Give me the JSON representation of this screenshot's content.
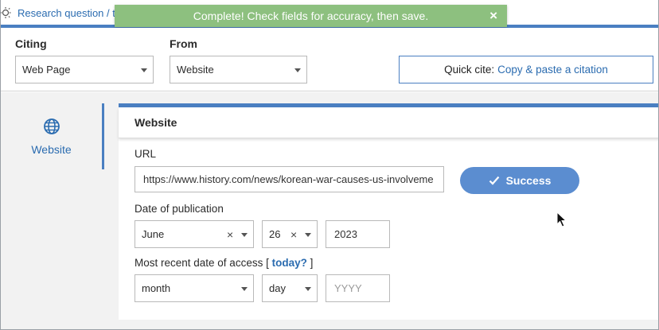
{
  "breadcrumb": "Research question / t",
  "toast": {
    "message": "Complete! Check fields for accuracy, then save.",
    "close": "×"
  },
  "citing": {
    "label": "Citing",
    "value": "Web Page"
  },
  "from": {
    "label": "From",
    "value": "Website"
  },
  "quick_cite": {
    "label": "Quick cite:",
    "link": "Copy & paste a citation"
  },
  "side_tab": {
    "label": "Website",
    "icon": "globe-icon"
  },
  "panel": {
    "title": "Website",
    "url_label": "URL",
    "url_value": "https://www.history.com/news/korean-war-causes-us-involveme",
    "success_label": "Success",
    "pub_label": "Date of publication",
    "pub_month": "June",
    "pub_day": "26",
    "pub_year": "2023",
    "access_label": "Most recent date of access [",
    "access_today": "today?",
    "access_close": "]",
    "access_month": "month",
    "access_day": "day",
    "access_year_placeholder": "YYYY",
    "clear": "×"
  },
  "colors": {
    "accent": "#4a7fc1",
    "toast": "#8dc07f",
    "success": "#5b8dd0",
    "link": "#2b6cb0"
  }
}
